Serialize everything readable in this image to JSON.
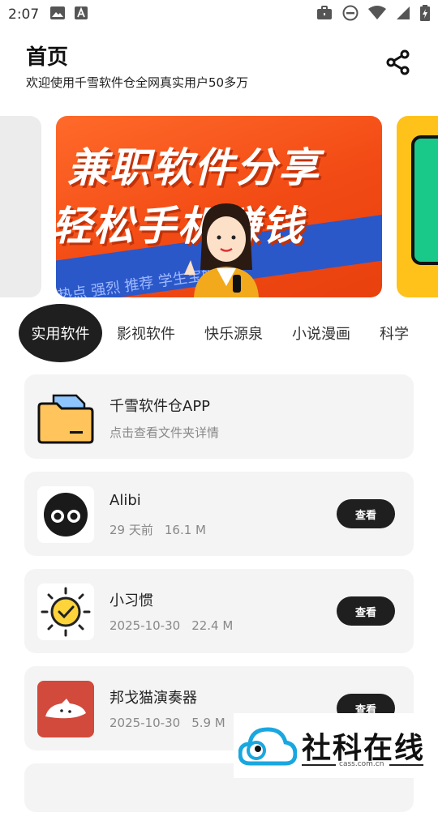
{
  "status_bar": {
    "time": "2:07"
  },
  "header": {
    "title": "首页",
    "subtitle": "欢迎使用千雪软件仓全网真实用户50多万"
  },
  "banner": {
    "line1": "兼职软件分享",
    "line2": "轻松手机赚钱",
    "tags": "热点   强烈   推荐   学生宝妈   在"
  },
  "tabs": [
    "实用软件",
    "影视软件",
    "快乐源泉",
    "小说漫画",
    "科学"
  ],
  "folder_card": {
    "title": "千雪软件仓APP",
    "subtitle": "点击查看文件夹详情"
  },
  "apps": [
    {
      "name": "Alibi",
      "date": "29 天前",
      "size": "16.1 M",
      "button": "查看",
      "icon": "owl-eyes-icon"
    },
    {
      "name": "小习惯",
      "date": "2025-10-30",
      "size": "22.4 M",
      "button": "查看",
      "icon": "sun-check-icon"
    },
    {
      "name": "邦戈猫演奏器",
      "date": "2025-10-30",
      "size": "5.9 M",
      "button": "查看",
      "icon": "bongo-cat-icon"
    }
  ],
  "watermark": {
    "text": "社科在线",
    "url": "cass.com.cn"
  }
}
